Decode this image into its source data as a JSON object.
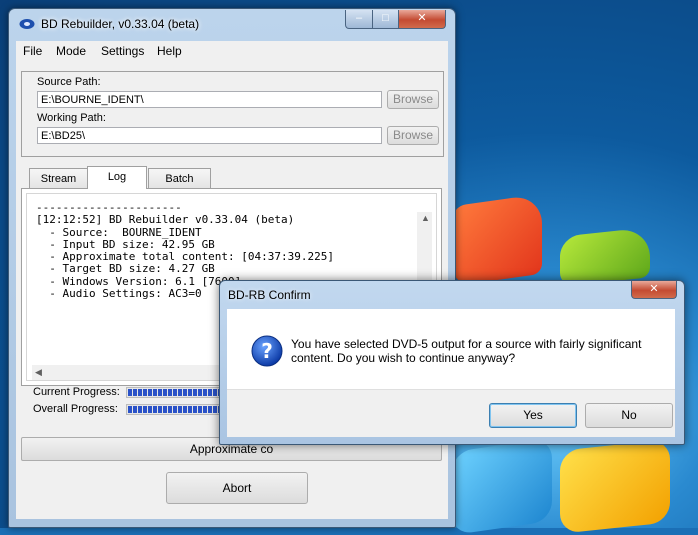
{
  "main_window": {
    "title": "BD Rebuilder, v0.33.04 (beta)",
    "controls": {
      "minimize": "–",
      "maximize": "□",
      "close": "✕"
    },
    "menu": [
      "File",
      "Mode",
      "Settings",
      "Help"
    ],
    "source_path_label": "Source Path:",
    "source_path_value": "E:\\BOURNE_IDENT\\",
    "working_path_label": "Working Path:",
    "working_path_value": "E:\\BD25\\",
    "browse_label": "Browse",
    "tabs": [
      "Stream",
      "Log",
      "Batch"
    ],
    "active_tab": "Log",
    "log_text": "----------------------\n[12:12:52] BD Rebuilder v0.33.04 (beta)\n  - Source:  BOURNE_IDENT\n  - Input BD size: 42.95 GB\n  - Approximate total content: [04:37:39.225]\n  - Target BD size: 4.27 GB\n  - Windows Version: 6.1 [7600]\n  - Audio Settings: AC3=0",
    "current_progress_label": "Current Progress:",
    "current_progress": 0.55,
    "overall_progress_label": "Overall Progress:",
    "overall_progress": 0.55,
    "approx_button_label": "Approximate co",
    "abort_label": "Abort"
  },
  "dialog": {
    "title": "BD-RB Confirm",
    "close": "✕",
    "message": "You have selected DVD-5 output for a source with fairly significant content.  Do you wish to continue anyway?",
    "yes_label": "Yes",
    "no_label": "No"
  },
  "colors": {
    "progress_fill": "#2a52c8",
    "titlebar": "#bcd4ec",
    "close_button": "#c44b32"
  }
}
